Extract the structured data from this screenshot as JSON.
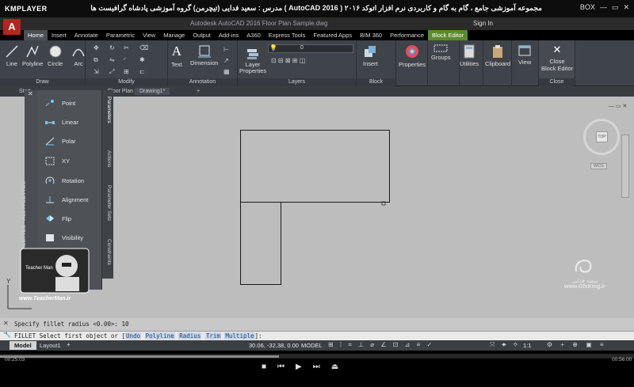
{
  "player": {
    "logo": "KMPLAYER",
    "title": "مجموعه آموزشی جامع ، گام به گام و کاربردی نرم افزار اتوکد ۲۰۱۶ ( AutoCAD 2016 ) مدرس : سعید فدایی (تیچرمن) گروه آموزشی پادشاه گرافیست ها",
    "controls": [
      "BOX",
      "—",
      "▭",
      "✕"
    ]
  },
  "app": {
    "logo": "A",
    "title": "Autodesk AutoCAD 2016   Floor Plan Sample.dwg",
    "signin": "Sign In"
  },
  "ribbon_tabs": [
    "Home",
    "Insert",
    "Annotate",
    "Parametric",
    "View",
    "Manage",
    "Output",
    "Add-ins",
    "A360",
    "Express Tools",
    "Featured Apps",
    "BIM 360",
    "Performance",
    "Block Editor"
  ],
  "panels": {
    "draw": {
      "label": "Draw",
      "buttons": [
        "Line",
        "Polyline",
        "Circle",
        "Arc"
      ]
    },
    "modify": {
      "label": "Modify"
    },
    "annotation": {
      "label": "Annotation",
      "buttons": [
        "Text",
        "Dimension"
      ]
    },
    "layers": {
      "label": "Layers",
      "button": "Layer Properties",
      "layer_value": "0"
    },
    "block": {
      "label": "Block",
      "button": "Insert"
    },
    "properties": {
      "button": "Properties"
    },
    "groups": {
      "button": "Groups"
    },
    "utilities": {
      "button": "Utilities"
    },
    "clipboard": {
      "button": "Clipboard"
    },
    "view": {
      "button": "View"
    },
    "close": {
      "label": "Close",
      "button_line1": "Close",
      "button_line2": "Block Editor"
    }
  },
  "doc_tabs": [
    "Start",
    "Floor Plan Sample*",
    "Drawing1*"
  ],
  "palette": {
    "title": "TOOL PALETTES - ALL PALETTES",
    "items": [
      "Point",
      "Linear",
      "Polar",
      "XY",
      "Rotation",
      "Alignment",
      "Flip",
      "Visibility"
    ],
    "tabs": [
      "Parameters",
      "Actions",
      "Parameter Sets",
      "Constraints"
    ]
  },
  "viewcube": {
    "top": "TOP",
    "wcs": "WCS"
  },
  "watermarks": {
    "right_name": "سعید فدایی",
    "right_site": "www.GfxKing.ir",
    "left_site": "www.TeacherMan.ir",
    "left_badge": "Teacher Man"
  },
  "command": {
    "history": "Specify fillet radius <0.00>: 10",
    "prompt": "FILLET Select first object or [",
    "options": [
      "Undo",
      "Polyline",
      "Radius",
      "Trim",
      "Multiple"
    ],
    "end": "]:"
  },
  "status": {
    "layouts": [
      "Model",
      "Layout1"
    ],
    "coords": "30.06, -32.38, 0.00",
    "model": "MODEL",
    "scale": "1:1"
  },
  "video": {
    "progress": 0.44,
    "elapsed": "00:25:03",
    "total": "00:56:00"
  },
  "colors": {
    "ribbon": "#3f444a",
    "canvas": "#bdbdbd",
    "block_editor_tab": "#5a8a2e",
    "app_logo": "#b3261e"
  }
}
